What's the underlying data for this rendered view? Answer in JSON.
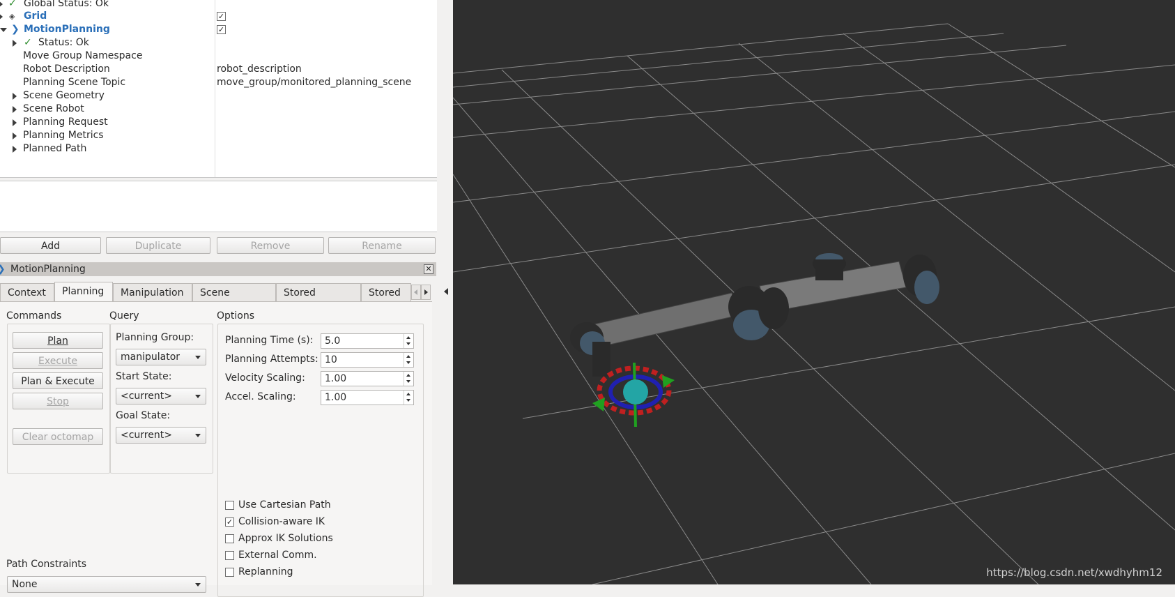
{
  "displays": {
    "items": [
      {
        "label": "Global Status: Ok"
      },
      {
        "label": "Grid",
        "checked": true
      },
      {
        "label": "MotionPlanning",
        "checked": true
      },
      {
        "label": "Status: Ok"
      },
      {
        "label": "Move Group Namespace",
        "value": ""
      },
      {
        "label": "Robot Description",
        "value": "robot_description"
      },
      {
        "label": "Planning Scene Topic",
        "value": "move_group/monitored_planning_scene"
      },
      {
        "label": "Scene Geometry"
      },
      {
        "label": "Scene Robot"
      },
      {
        "label": "Planning Request"
      },
      {
        "label": "Planning Metrics"
      },
      {
        "label": "Planned Path"
      }
    ],
    "checkmark": "✓"
  },
  "display_buttons": {
    "add": "Add",
    "duplicate": "Duplicate",
    "remove": "Remove",
    "rename": "Rename"
  },
  "motion_panel": {
    "title": "MotionPlanning",
    "tabs": [
      "Context",
      "Planning",
      "Manipulation",
      "Scene Objects",
      "Stored Scenes",
      "Stored S"
    ],
    "active_tab": "Planning",
    "commands": {
      "title": "Commands",
      "plan": "Plan",
      "execute": "Execute",
      "plan_execute": "Plan & Execute",
      "stop": "Stop",
      "clear_octomap": "Clear octomap"
    },
    "query": {
      "title": "Query",
      "planning_group_label": "Planning Group:",
      "planning_group": "manipulator",
      "start_state_label": "Start State:",
      "start_state": "<current>",
      "goal_state_label": "Goal State:",
      "goal_state": "<current>"
    },
    "options": {
      "title": "Options",
      "planning_time_label": "Planning Time (s):",
      "planning_time": "5.0",
      "planning_attempts_label": "Planning Attempts:",
      "planning_attempts": "10",
      "velocity_scaling_label": "Velocity Scaling:",
      "velocity_scaling": "1.00",
      "accel_scaling_label": "Accel. Scaling:",
      "accel_scaling": "1.00",
      "checkboxes": [
        {
          "label": "Use Cartesian Path",
          "checked": false
        },
        {
          "label": "Collision-aware IK",
          "checked": true
        },
        {
          "label": "Approx IK Solutions",
          "checked": false
        },
        {
          "label": "External Comm.",
          "checked": false
        },
        {
          "label": "Replanning",
          "checked": false
        }
      ]
    },
    "path_constraints": {
      "title": "Path Constraints",
      "value": "None"
    }
  },
  "viewport": {
    "watermark": "https://blog.csdn.net/xwdhyhm12",
    "background": "#2f2f2f",
    "grid_color": "#8a8a8a"
  },
  "colors": {
    "accent_blue": "#2a6fb8",
    "status_green": "#2a8a2a"
  }
}
